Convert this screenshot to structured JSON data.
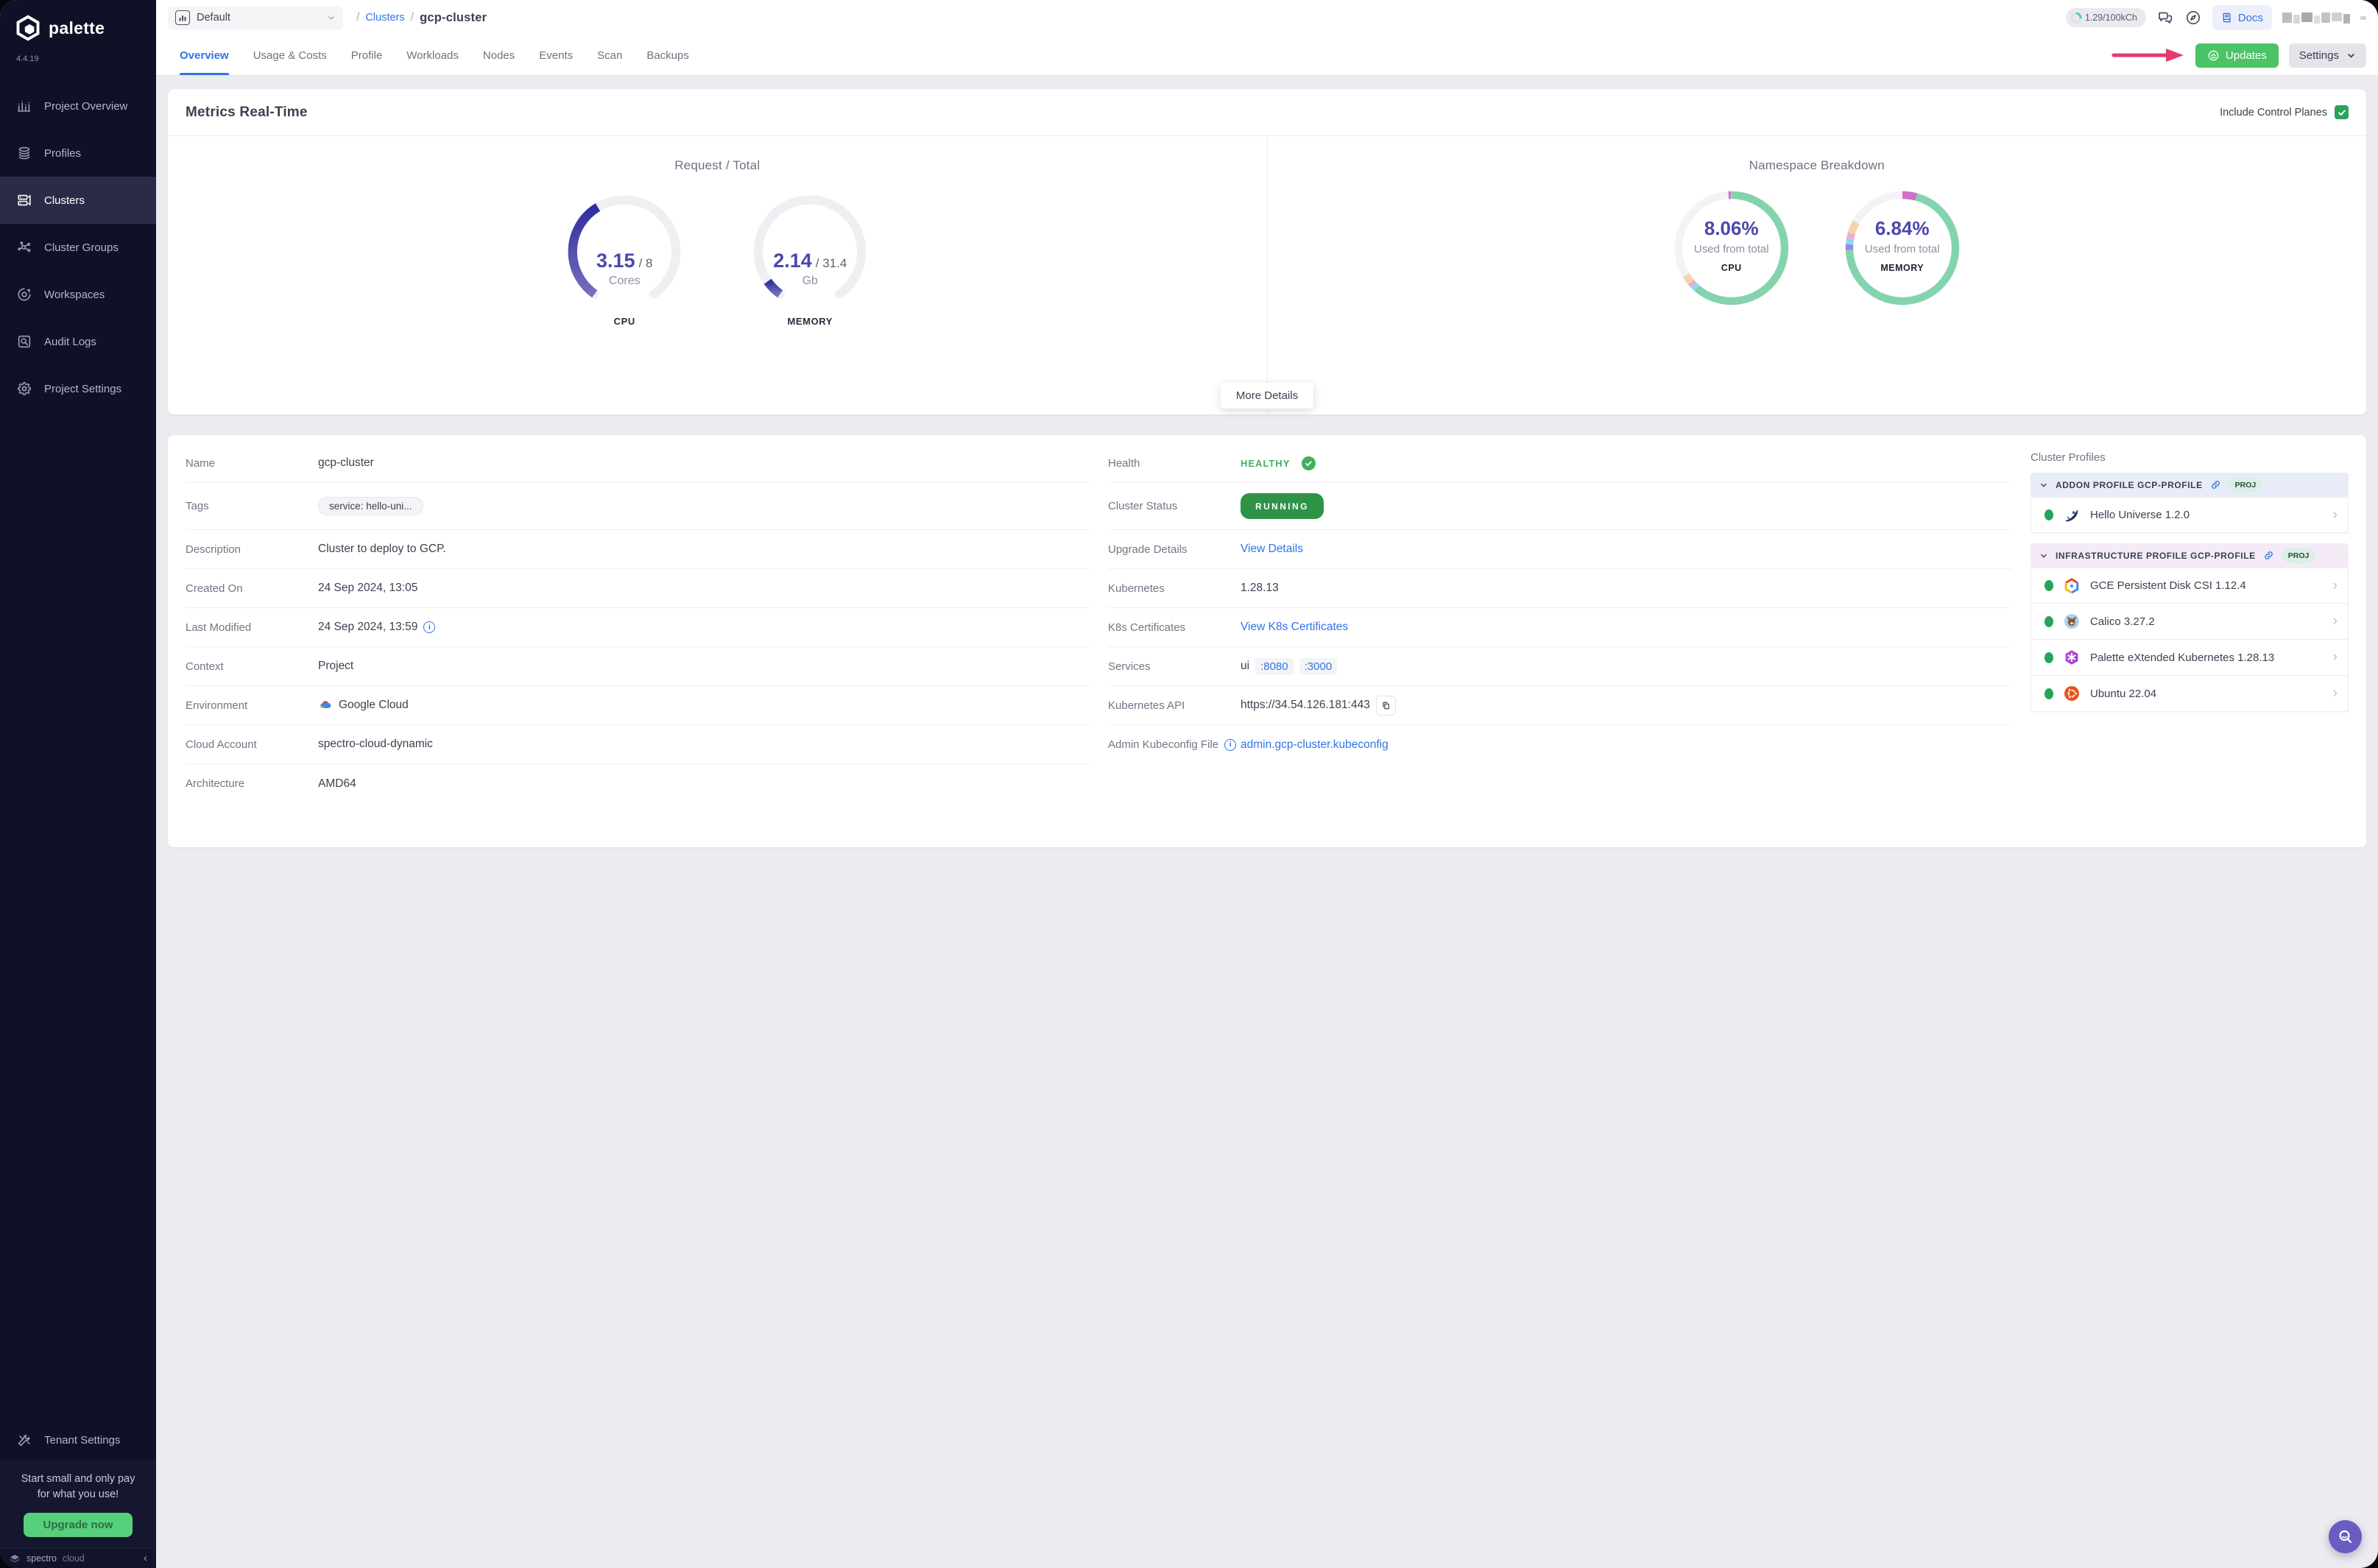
{
  "app": {
    "brand": "palette",
    "version": "4.4.19"
  },
  "sidebar": {
    "items": [
      {
        "label": "Project Overview"
      },
      {
        "label": "Profiles"
      },
      {
        "label": "Clusters"
      },
      {
        "label": "Cluster Groups"
      },
      {
        "label": "Workspaces"
      },
      {
        "label": "Audit Logs"
      },
      {
        "label": "Project Settings"
      }
    ],
    "selected": "Clusters",
    "tenant_settings": "Tenant Settings",
    "promo": {
      "line1": "Start small and only pay",
      "line2": "for what you use!",
      "cta": "Upgrade now"
    },
    "footer": {
      "brand_bold": "spectro",
      "brand_light": "cloud",
      "collapse": "‹"
    }
  },
  "topbar": {
    "project": "Default",
    "breadcrumb_sep": "/",
    "breadcrumb_link": "Clusters",
    "breadcrumb_current": "gcp-cluster",
    "usage": "1.29/100kCh",
    "docs": "Docs"
  },
  "tabs": {
    "items": [
      "Overview",
      "Usage & Costs",
      "Profile",
      "Workloads",
      "Nodes",
      "Events",
      "Scan",
      "Backups"
    ],
    "active": "Overview"
  },
  "actions": {
    "updates": "Updates",
    "settings": "Settings"
  },
  "metrics": {
    "title": "Metrics Real-Time",
    "include_control_planes": "Include Control Planes",
    "include_checked": true,
    "more_details": "More Details"
  },
  "chart_data": [
    {
      "type": "gauge",
      "id": "gauge-cpu",
      "group_title": "Request / Total",
      "value": 3.15,
      "total": 8,
      "value_label": "3.15",
      "total_label": "/ 8",
      "unit": "Cores",
      "label": "CPU",
      "arc_degrees": 290,
      "fill_colors": [
        "#736fbc",
        "#322da1"
      ],
      "track_color": "#efeff3"
    },
    {
      "type": "gauge",
      "id": "gauge-memory",
      "group_title": "Request / Total",
      "value": 2.14,
      "total": 31.4,
      "value_label": "2.14",
      "total_label": "/ 31.4",
      "unit": "Gb",
      "label": "MEMORY",
      "arc_degrees": 290,
      "fill_colors": [
        "#736fbc",
        "#322da1"
      ],
      "track_color": "#efeff3"
    },
    {
      "type": "donut",
      "id": "donut-cpu",
      "group_title": "Namespace Breakdown",
      "center_value": "8.06%",
      "center_caption": "Used from total",
      "label": "CPU",
      "segments": [
        {
          "name": "green",
          "value": 61.5,
          "color": "#83d4ad"
        },
        {
          "name": "light-blue",
          "value": 1.3,
          "color": "#8fd8f3"
        },
        {
          "name": "pink",
          "value": 1.2,
          "color": "#f0aad5"
        },
        {
          "name": "peach",
          "value": 2.6,
          "color": "#f4d5ab"
        },
        {
          "name": "free",
          "value": 32.6,
          "color": "#f3f3f6"
        },
        {
          "name": "magenta",
          "value": 0.8,
          "color": "#cf70c6"
        }
      ]
    },
    {
      "type": "donut",
      "id": "donut-memory",
      "group_title": "Namespace Breakdown",
      "center_value": "6.84%",
      "center_caption": "Used from total",
      "label": "MEMORY",
      "segments": [
        {
          "name": "magenta",
          "value": 4.2,
          "color": "#cf70c6"
        },
        {
          "name": "green",
          "value": 70.3,
          "color": "#83d4ad"
        },
        {
          "name": "purple",
          "value": 1.7,
          "color": "#958ae6"
        },
        {
          "name": "light-blue",
          "value": 1.7,
          "color": "#8fd8f3"
        },
        {
          "name": "pink",
          "value": 1.7,
          "color": "#f0aad5"
        },
        {
          "name": "peach",
          "value": 3.6,
          "color": "#f4d5ab"
        },
        {
          "name": "free",
          "value": 16.8,
          "color": "#f3f3f6"
        }
      ]
    }
  ],
  "details": {
    "left": [
      {
        "label": "Name",
        "value": "gcp-cluster"
      },
      {
        "label": "Tags",
        "value": "service: hello-uni..."
      },
      {
        "label": "Description",
        "value": "Cluster to deploy to GCP."
      },
      {
        "label": "Created On",
        "value": "24 Sep 2024, 13:05"
      },
      {
        "label": "Last Modified",
        "value": "24 Sep 2024, 13:59"
      },
      {
        "label": "Context",
        "value": "Project"
      },
      {
        "label": "Environment",
        "value": "Google Cloud"
      },
      {
        "label": "Cloud Account",
        "value": "spectro-cloud-dynamic"
      },
      {
        "label": "Architecture",
        "value": "AMD64"
      }
    ],
    "middle": [
      {
        "label": "Health",
        "value": "HEALTHY"
      },
      {
        "label": "Cluster Status",
        "value": "RUNNING"
      },
      {
        "label": "Upgrade Details",
        "value": "View Details"
      },
      {
        "label": "Kubernetes",
        "value": "1.28.13"
      },
      {
        "label": "K8s Certificates",
        "value": "View K8s Certificates"
      },
      {
        "label": "Services",
        "value": "ui",
        "ports": [
          ":8080",
          ":3000"
        ]
      },
      {
        "label": "Kubernetes API",
        "value": "https://34.54.126.181:443"
      },
      {
        "label": "Admin Kubeconfig File",
        "value": "admin.gcp-cluster.kubeconfig"
      }
    ]
  },
  "profiles": {
    "title": "Cluster Profiles",
    "sections": [
      {
        "name": "ADDON PROFILE GCP-PROFILE",
        "badge": "PROJ",
        "tint": "#e8ecf8",
        "items": [
          {
            "name": "Hello Universe 1.2.0"
          }
        ]
      },
      {
        "name": "INFRASTRUCTURE PROFILE GCP-PROFILE",
        "badge": "PROJ",
        "tint": "#f4ebf7",
        "items": [
          {
            "name": "GCE Persistent Disk CSI 1.12.4"
          },
          {
            "name": "Calico 3.27.2"
          },
          {
            "name": "Palette eXtended Kubernetes 1.28.13"
          },
          {
            "name": "Ubuntu 22.04"
          }
        ]
      }
    ]
  },
  "colors": {
    "sidebar-bg": "#0f1126",
    "sidebar-active-bg": "#2a2c47",
    "sidebar-text": "#b4b8cc",
    "accent-blue": "#3174e4",
    "green": "#4cc366",
    "dark-green": "#2e9247",
    "health-green": "#41b05c",
    "indigo": "#4b48ac",
    "annotation-pink": "#e73a6e",
    "fab-purple": "#695cc2",
    "content-bg": "#ebebf0",
    "promo-green": "#57d07e"
  }
}
